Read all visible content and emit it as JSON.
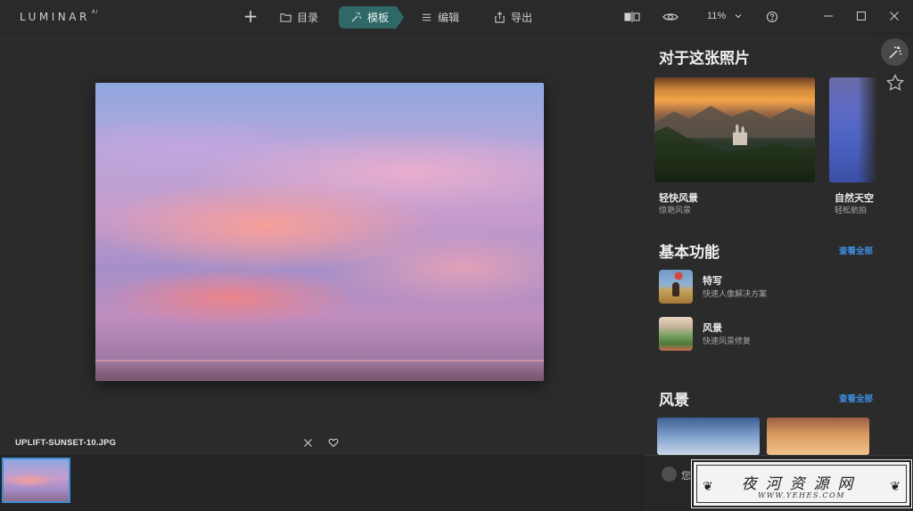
{
  "app": {
    "logo": "LUMINAR",
    "logo_sup": "AI"
  },
  "toolbar": {
    "add_label": "+",
    "catalog_label": "目录",
    "templates_label": "模板",
    "edit_label": "编辑",
    "export_label": "导出",
    "zoom_value": "11%"
  },
  "canvas": {
    "file_name": "UPLIFT-SUNSET-10.JPG"
  },
  "panel": {
    "for_this_photo_title": "对于这张照片",
    "cards": [
      {
        "title": "轻快风景",
        "subtitle": "惊艳风景"
      },
      {
        "title": "自然天空",
        "subtitle": "轻松航拍"
      }
    ],
    "essentials_title": "基本功能",
    "see_all_label": "查看全部",
    "features": [
      {
        "title": "特写",
        "subtitle": "快速人像解决方案"
      },
      {
        "title": "风景",
        "subtitle": "快速风景修复"
      }
    ],
    "landscape_title": "风景",
    "bottom_text": "您"
  },
  "watermark": {
    "title": "夜河资源网",
    "url": "WWW.YEHES.COM"
  },
  "colors": {
    "accent": "#2f6866",
    "link": "#3d8fe0",
    "selection": "#3f8fd6"
  },
  "icons": {
    "catalog": "folder-icon",
    "templates": "magic-wand-icon",
    "edit": "sliders-icon",
    "export": "share-icon",
    "compare": "compare-icon",
    "view": "eye-icon",
    "help": "help-icon",
    "favorite": "star-icon"
  }
}
